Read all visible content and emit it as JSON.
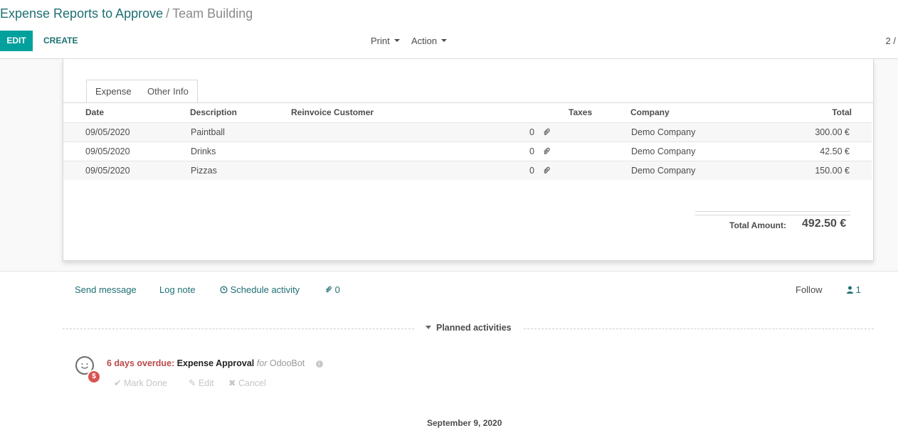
{
  "breadcrumb": {
    "parent": "Expense Reports to Approve",
    "separator": "/",
    "current": "Team Building"
  },
  "toolbar": {
    "edit": "EDIT",
    "create": "CREATE",
    "print": "Print",
    "action": "Action",
    "pager": "2 /"
  },
  "tabs": {
    "expense": "Expense",
    "other_info": "Other Info"
  },
  "table": {
    "headers": {
      "date": "Date",
      "description": "Description",
      "reinvoice": "Reinvoice Customer",
      "taxes": "Taxes",
      "company": "Company",
      "total": "Total"
    },
    "rows": [
      {
        "date": "09/05/2020",
        "description": "Paintball",
        "attachments": "0",
        "company": "Demo Company",
        "total": "300.00 €"
      },
      {
        "date": "09/05/2020",
        "description": "Drinks",
        "attachments": "0",
        "company": "Demo Company",
        "total": "42.50 €"
      },
      {
        "date": "09/05/2020",
        "description": "Pizzas",
        "attachments": "0",
        "company": "Demo Company",
        "total": "150.00 €"
      }
    ]
  },
  "totals": {
    "label": "Total Amount:",
    "value": "492.50 €"
  },
  "chatter": {
    "send_message": "Send message",
    "log_note": "Log note",
    "schedule_activity": "Schedule activity",
    "attachments": "0",
    "follow": "Follow",
    "followers": "1"
  },
  "activities": {
    "section_title": "Planned activities",
    "item": {
      "overdue": "6 days overdue:",
      "title": "Expense Approval",
      "for": "for",
      "user": "OdooBot",
      "badge": "$"
    },
    "actions": {
      "mark_done": "Mark Done",
      "edit": "Edit",
      "cancel": "Cancel"
    }
  },
  "date_separator": "September 9, 2020",
  "colors": {
    "primary": "#00a09d",
    "link": "#1f6f73",
    "overdue": "#b94a48",
    "badge": "#d9534f"
  },
  "icons": [
    "caret-down-icon",
    "paperclip-icon",
    "clock-icon",
    "user-icon",
    "check-icon",
    "pencil-icon",
    "times-icon",
    "info-icon",
    "dollar-icon",
    "smiley-face-icon"
  ]
}
